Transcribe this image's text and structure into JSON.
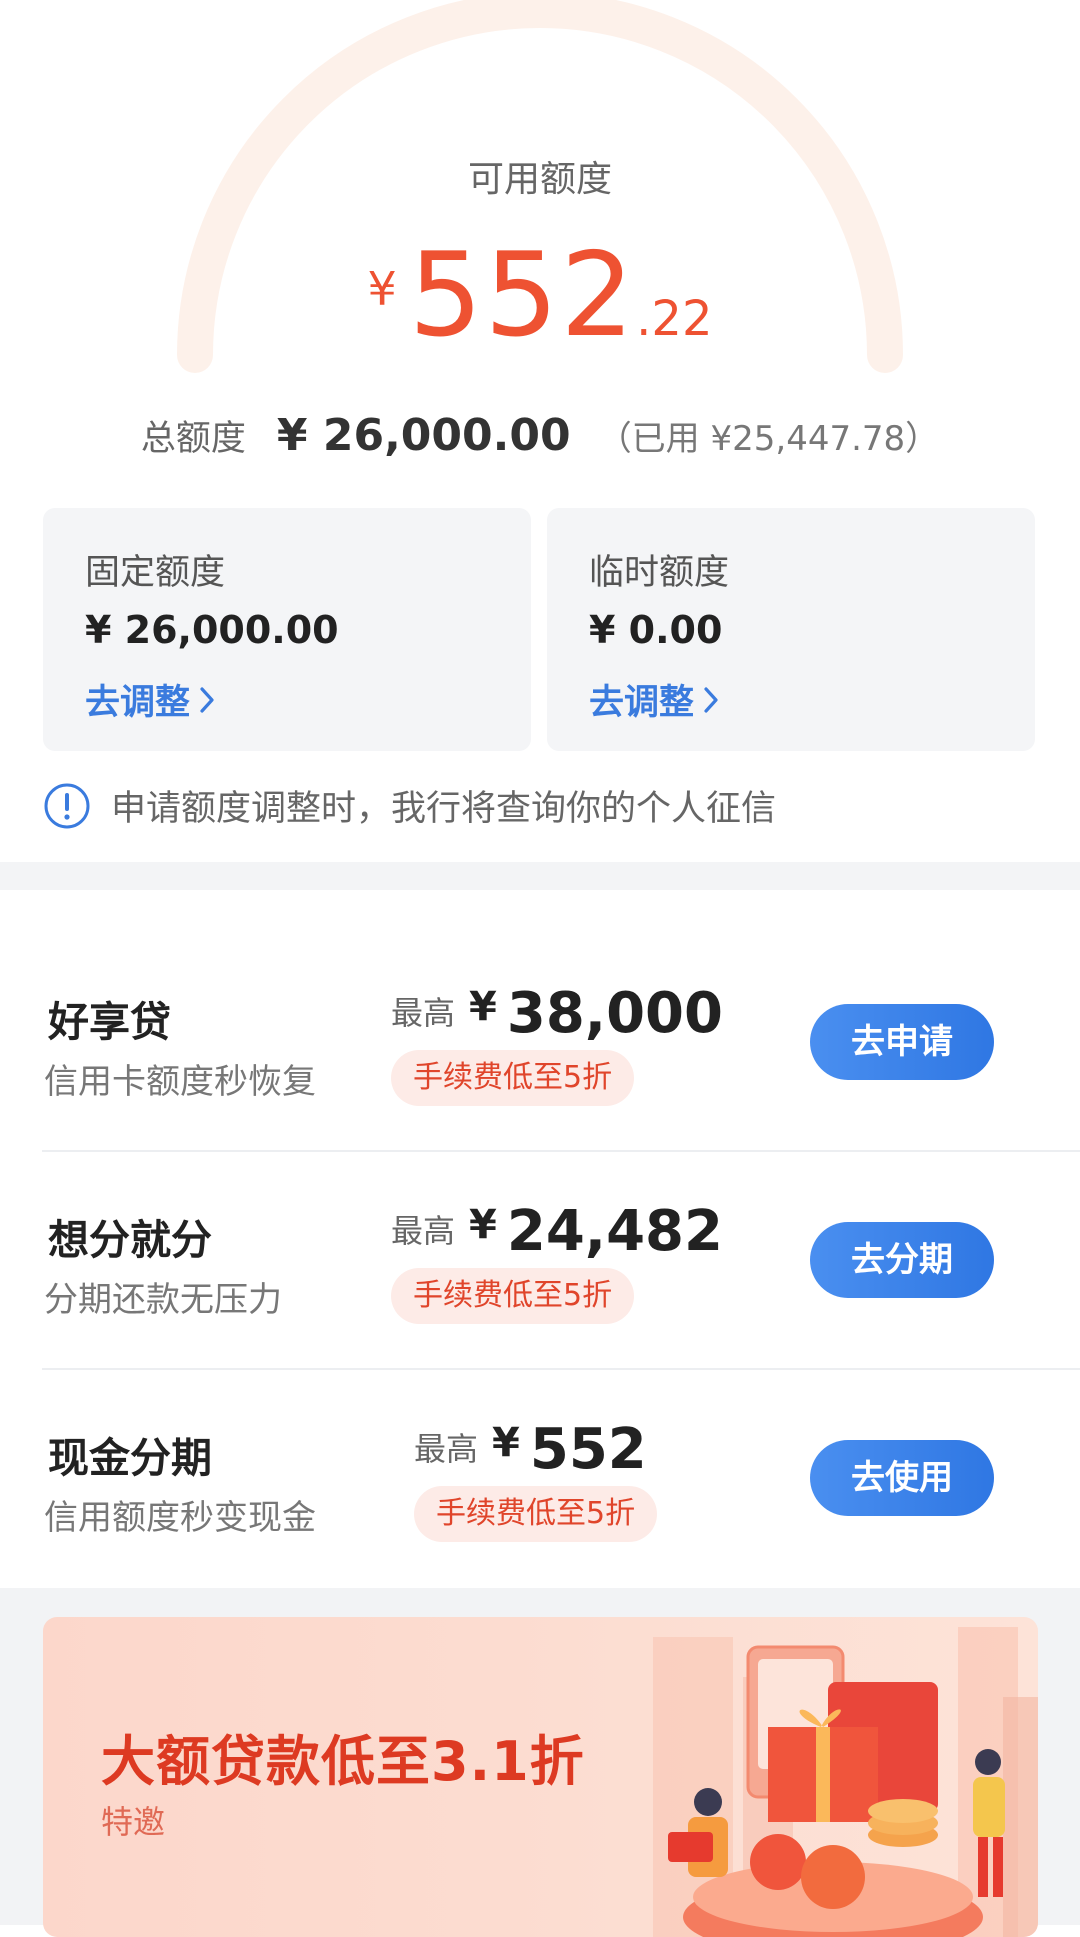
{
  "available": {
    "label": "可用额度",
    "currency": "¥",
    "integer": "552",
    "decimal": ".22"
  },
  "total": {
    "label": "总额度",
    "value": "¥ 26,000.00",
    "used": "（已用 ¥25,447.78）"
  },
  "quota_cards": [
    {
      "title": "固定额度",
      "value": "¥ 26,000.00",
      "action": "去调整"
    },
    {
      "title": "临时额度",
      "value": "¥ 0.00",
      "action": "去调整"
    }
  ],
  "notice": "申请额度调整时，我行将查询你的个人征信",
  "products": [
    {
      "name": "好享贷",
      "desc": "信用卡额度秒恢复",
      "max_label": "最高",
      "currency": "¥",
      "max_value": "38,000",
      "fee": "手续费低至5折",
      "button": "去申请"
    },
    {
      "name": "想分就分",
      "desc": "分期还款无压力",
      "max_label": "最高",
      "currency": "¥",
      "max_value": "24,482",
      "fee": "手续费低至5折",
      "button": "去分期"
    },
    {
      "name": "现金分期",
      "desc": "信用额度秒变现金",
      "max_label": "最高",
      "currency": "¥",
      "max_value": "552",
      "fee": "手续费低至5折",
      "button": "去使用"
    }
  ],
  "banner": {
    "title": "大额贷款低至3.1折",
    "subtitle": "特邀"
  },
  "colors": {
    "accent_red": "#ee5232",
    "link_blue": "#3a7bde",
    "button_blue": "#2f77e3",
    "gauge_track": "#fdf0e9"
  },
  "gauge_progress": 0.0212
}
